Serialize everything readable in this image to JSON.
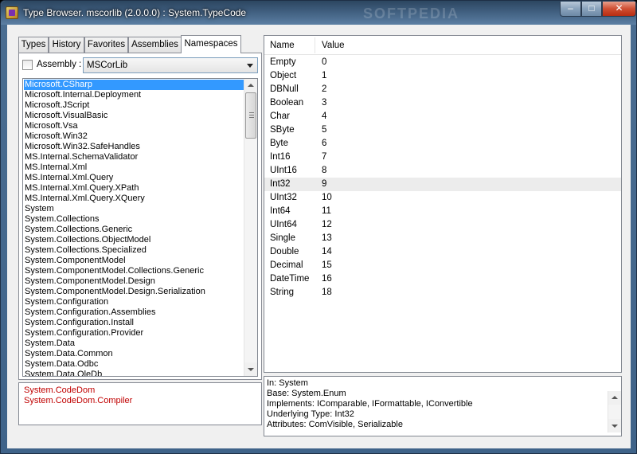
{
  "window": {
    "title": "Type Browser. mscorlib (2.0.0.0) : System.TypeCode",
    "watermark": "SOFTPEDIA",
    "minimize_glyph": "–",
    "maximize_glyph": "□",
    "close_glyph": "✕"
  },
  "tabs": [
    "Types",
    "History",
    "Favorites",
    "Assemblies",
    "Namespaces"
  ],
  "active_tab": "Namespaces",
  "assembly": {
    "label": "Assembly :",
    "checked": false,
    "selected": "MSCorLib"
  },
  "namespaces": [
    "Microsoft.CSharp",
    "Microsoft.Internal.Deployment",
    "Microsoft.JScript",
    "Microsoft.VisualBasic",
    "Microsoft.Vsa",
    "Microsoft.Win32",
    "Microsoft.Win32.SafeHandles",
    "MS.Internal.SchemaValidator",
    "MS.Internal.Xml",
    "MS.Internal.Xml.Query",
    "MS.Internal.Xml.Query.XPath",
    "MS.Internal.Xml.Query.XQuery",
    "System",
    "System.Collections",
    "System.Collections.Generic",
    "System.Collections.ObjectModel",
    "System.Collections.Specialized",
    "System.ComponentModel",
    "System.ComponentModel.Collections.Generic",
    "System.ComponentModel.Design",
    "System.ComponentModel.Design.Serialization",
    "System.Configuration",
    "System.Configuration.Assemblies",
    "System.Configuration.Install",
    "System.Configuration.Provider",
    "System.Data",
    "System.Data.Common",
    "System.Data.Odbc",
    "System.Data.OleDb"
  ],
  "selected_namespace": "Microsoft.CSharp",
  "references": [
    "System.CodeDom",
    "System.CodeDom.Compiler"
  ],
  "colors": {
    "reference_text": "#c00000",
    "selection": "#3399ff"
  },
  "members": {
    "headers": {
      "name": "Name",
      "value": "Value"
    },
    "rows": [
      {
        "name": "Empty",
        "value": "0"
      },
      {
        "name": "Object",
        "value": "1"
      },
      {
        "name": "DBNull",
        "value": "2"
      },
      {
        "name": "Boolean",
        "value": "3"
      },
      {
        "name": "Char",
        "value": "4"
      },
      {
        "name": "SByte",
        "value": "5"
      },
      {
        "name": "Byte",
        "value": "6"
      },
      {
        "name": "Int16",
        "value": "7"
      },
      {
        "name": "UInt16",
        "value": "8"
      },
      {
        "name": "Int32",
        "value": "9"
      },
      {
        "name": "UInt32",
        "value": "10"
      },
      {
        "name": "Int64",
        "value": "11"
      },
      {
        "name": "UInt64",
        "value": "12"
      },
      {
        "name": "Single",
        "value": "13"
      },
      {
        "name": "Double",
        "value": "14"
      },
      {
        "name": "Decimal",
        "value": "15"
      },
      {
        "name": "DateTime",
        "value": "16"
      },
      {
        "name": "String",
        "value": "18"
      }
    ],
    "highlighted": "Int32"
  },
  "info": [
    "In: System",
    "Base: System.Enum",
    "Implements: IComparable, IFormattable, IConvertible",
    "Underlying Type: Int32",
    "Attributes: ComVisible, Serializable"
  ]
}
